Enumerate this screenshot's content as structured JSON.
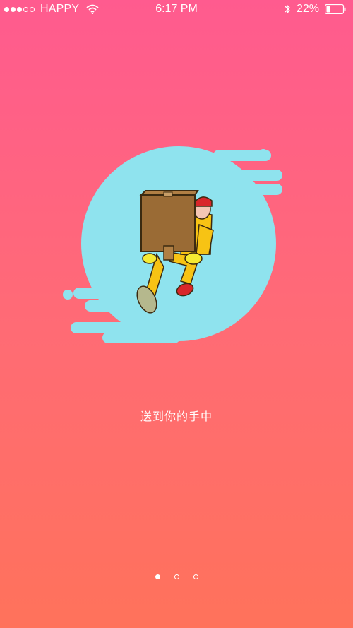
{
  "status_bar": {
    "carrier": "HAPPY",
    "time": "6:17 PM",
    "battery_percent": "22%",
    "signal_filled": 3,
    "signal_total": 5,
    "icons": [
      "signal-dots-icon",
      "wifi-icon",
      "bluetooth-icon",
      "battery-icon"
    ]
  },
  "hero": {
    "caption": "送到你的手中",
    "illustration": "courier-carrying-box-icon",
    "colors": {
      "blob": "#8fe3ee",
      "box": "#9a6b35",
      "uniform": "#f7c314",
      "cap": "#d8262a"
    }
  },
  "pager": {
    "total": 3,
    "active_index": 0
  },
  "colors": {
    "background_top": "#ff5b8f",
    "background_bottom": "#ff725b"
  }
}
